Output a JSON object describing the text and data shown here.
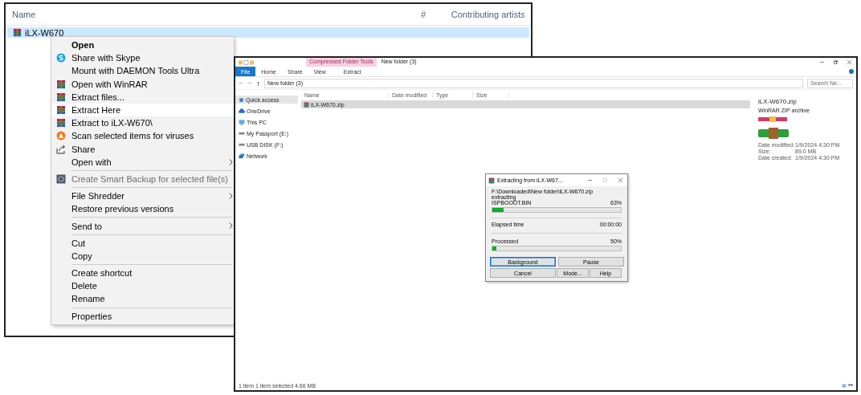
{
  "back_window": {
    "columns": [
      "Name",
      "#",
      "Contributing artists"
    ],
    "rows": [
      {
        "name": "iLX-W670",
        "selected": true
      }
    ]
  },
  "context_menu": {
    "sections": [
      [
        {
          "label": "Open",
          "kind": "plain",
          "bold": true,
          "selected": false,
          "disabled": false,
          "submenu": false
        },
        {
          "label": "Share with Skype",
          "kind": "skype",
          "selected": false,
          "disabled": false,
          "submenu": false
        },
        {
          "label": "Mount with DAEMON Tools Ultra",
          "kind": "plain",
          "selected": false,
          "disabled": false,
          "submenu": false
        },
        {
          "label": "Open with WinRAR",
          "kind": "winrar",
          "selected": false,
          "disabled": false,
          "submenu": false
        },
        {
          "label": "Extract files...",
          "kind": "winrar",
          "selected": false,
          "disabled": false,
          "submenu": false
        },
        {
          "label": "Extract Here",
          "kind": "winrar",
          "selected": true,
          "disabled": false,
          "submenu": false
        },
        {
          "label": "Extract to iLX-W670\\",
          "kind": "winrar",
          "selected": false,
          "disabled": false,
          "submenu": false
        },
        {
          "label": "Scan selected items for viruses",
          "kind": "antivirus",
          "selected": false,
          "disabled": false,
          "submenu": false
        },
        {
          "label": "Share",
          "kind": "share",
          "selected": false,
          "disabled": false,
          "submenu": false
        },
        {
          "label": "Open with",
          "kind": "plain",
          "selected": false,
          "disabled": false,
          "submenu": true
        }
      ],
      [
        {
          "label": "Create Smart Backup for selected file(s)",
          "kind": "backup",
          "selected": false,
          "disabled": true,
          "submenu": false
        }
      ],
      [
        {
          "label": "File Shredder",
          "kind": "plain",
          "selected": false,
          "disabled": false,
          "submenu": true
        },
        {
          "label": "Restore previous versions",
          "kind": "plain",
          "selected": false,
          "disabled": false,
          "submenu": false
        }
      ],
      [
        {
          "label": "Send to",
          "kind": "plain",
          "selected": false,
          "disabled": false,
          "submenu": true
        }
      ],
      [
        {
          "label": "Cut",
          "kind": "plain",
          "selected": false,
          "disabled": false,
          "submenu": false
        },
        {
          "label": "Copy",
          "kind": "plain",
          "selected": false,
          "disabled": false,
          "submenu": false
        }
      ],
      [
        {
          "label": "Create shortcut",
          "kind": "plain",
          "selected": false,
          "disabled": false,
          "submenu": false
        },
        {
          "label": "Delete",
          "kind": "plain",
          "selected": false,
          "disabled": false,
          "submenu": false
        },
        {
          "label": "Rename",
          "kind": "plain",
          "selected": false,
          "disabled": false,
          "submenu": false
        }
      ],
      [
        {
          "label": "Properties",
          "kind": "plain",
          "selected": false,
          "disabled": false,
          "submenu": false
        }
      ]
    ]
  },
  "explorer": {
    "title": "New folder (3)",
    "context_tab_group": "Compressed Folder Tools",
    "tabs": [
      {
        "label": "File",
        "selected": true
      },
      {
        "label": "Home",
        "selected": false
      },
      {
        "label": "Share",
        "selected": false
      },
      {
        "label": "View",
        "selected": false
      },
      {
        "label": "Extract",
        "selected": false
      }
    ],
    "address": "New folder (3)",
    "search": {
      "placeholder": "Search Ne..."
    },
    "sidebar": [
      {
        "label": "Quick access",
        "kind": "star",
        "selected": true
      },
      {
        "label": "OneDrive",
        "kind": "cloud",
        "selected": false
      },
      {
        "label": "This PC",
        "kind": "pc",
        "selected": false
      },
      {
        "label": "My Passport (E:)",
        "kind": "drive",
        "selected": false
      },
      {
        "label": "USB DISK (F:)",
        "kind": "drive",
        "selected": false
      },
      {
        "label": "Network",
        "kind": "network",
        "selected": false
      }
    ],
    "columns": [
      "Name",
      "Date modified",
      "Type",
      "Size"
    ],
    "files": [
      {
        "name": "iLX-W670.zip",
        "selected": true
      }
    ],
    "details": {
      "name": "iLX-W670.zip",
      "type": "WinRAR ZIP archive",
      "fields": [
        {
          "label": "Date modified:",
          "value": "1/9/2024 4:30 PM"
        },
        {
          "label": "Size:",
          "value": "89.0 MB"
        },
        {
          "label": "Date created:",
          "value": "1/9/2024 4:30 PM"
        }
      ]
    },
    "status_bar": "1 item    1 item selected  4.66 MB"
  },
  "dialog": {
    "title": "Extracting from iLX-W67...",
    "path": "F:\\Downloaded\\New folder\\iLX-W670.zip",
    "action": "extracting",
    "file": "ISPBOOOT.BIN",
    "file_percent": "63%",
    "file_progress": {
      "level": 0.09
    },
    "elapsed_label": "Elapsed time",
    "elapsed": "00:00:00",
    "processed_label": "Processed",
    "processed_percent": "50%",
    "processed_progress": {
      "level": 0.03
    },
    "buttons": [
      {
        "label": "Background",
        "focused": true
      },
      {
        "label": "Pause",
        "focused": false
      },
      {
        "label": "Cancel",
        "focused": false
      },
      {
        "label": "Mode...",
        "focused": false
      },
      {
        "label": "Help",
        "focused": false
      }
    ]
  }
}
